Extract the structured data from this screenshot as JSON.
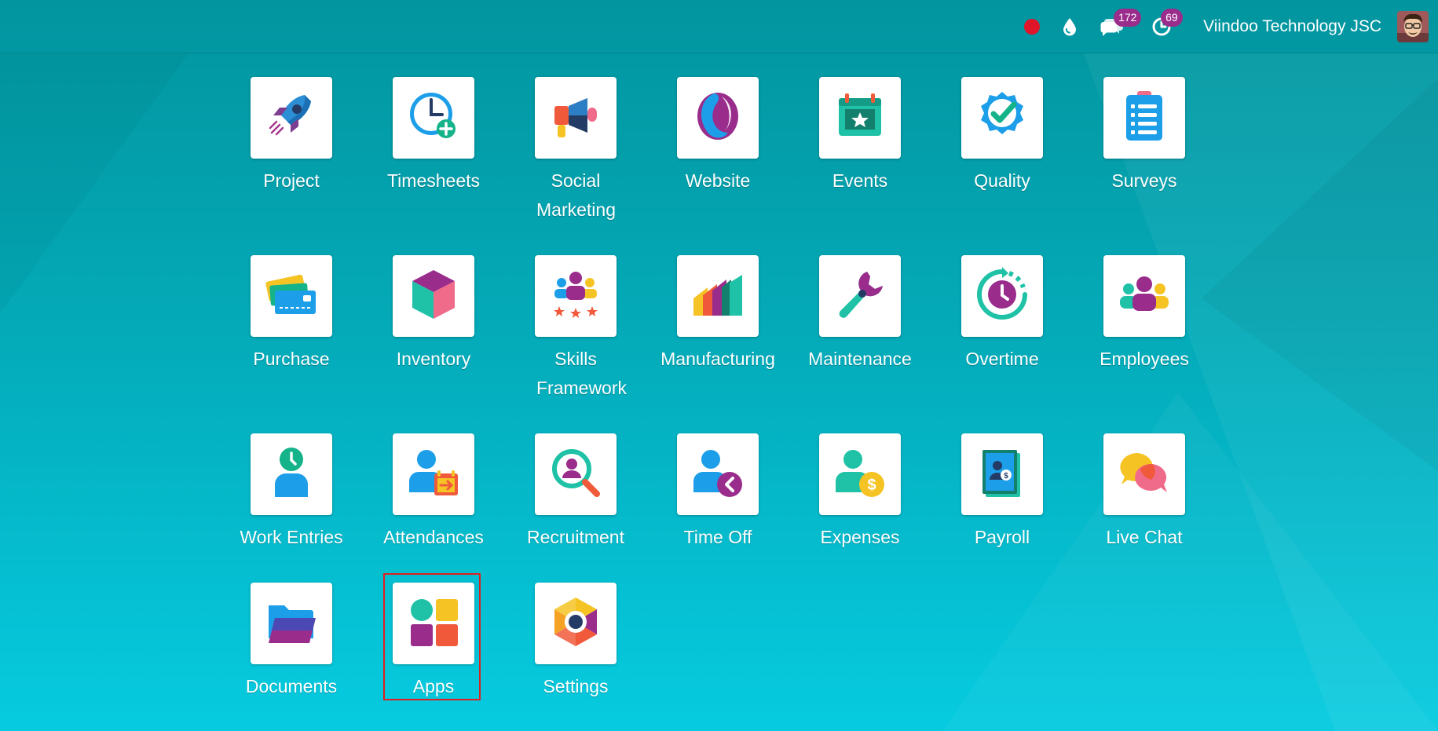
{
  "topbar": {
    "chat_badge": "172",
    "activity_badge": "69",
    "company_name": "Viindoo Technology JSC"
  },
  "apps": [
    {
      "label": "Project",
      "icon": "rocket-icon"
    },
    {
      "label": "Timesheets",
      "icon": "clock-plus-icon"
    },
    {
      "label": "Social Marketing",
      "icon": "megaphone-icon"
    },
    {
      "label": "Website",
      "icon": "website-globe-icon"
    },
    {
      "label": "Events",
      "icon": "calendar-star-icon"
    },
    {
      "label": "Quality",
      "icon": "check-badge-icon"
    },
    {
      "label": "Surveys",
      "icon": "clipboard-list-icon"
    },
    {
      "label": "Purchase",
      "icon": "credit-card-icon"
    },
    {
      "label": "Inventory",
      "icon": "cube-icon"
    },
    {
      "label": "Skills Framework",
      "icon": "people-stars-icon"
    },
    {
      "label": "Manufacturing",
      "icon": "factory-icon"
    },
    {
      "label": "Maintenance",
      "icon": "wrench-icon"
    },
    {
      "label": "Overtime",
      "icon": "clock-cycle-icon"
    },
    {
      "label": "Employees",
      "icon": "people-group-icon"
    },
    {
      "label": "Work Entries",
      "icon": "person-clock-icon"
    },
    {
      "label": "Attendances",
      "icon": "person-calendar-icon"
    },
    {
      "label": "Recruitment",
      "icon": "magnifier-person-icon"
    },
    {
      "label": "Time Off",
      "icon": "person-back-icon"
    },
    {
      "label": "Expenses",
      "icon": "person-dollar-icon"
    },
    {
      "label": "Payroll",
      "icon": "payslip-icon"
    },
    {
      "label": "Live Chat",
      "icon": "chat-bubbles-icon"
    },
    {
      "label": "Documents",
      "icon": "folder-icon"
    },
    {
      "label": "Apps",
      "icon": "apps-grid-icon"
    },
    {
      "label": "Settings",
      "icon": "settings-hexagon-icon"
    }
  ],
  "highlighted_app": "Apps",
  "colors": {
    "background_top": "#02959f",
    "background_bottom": "#06cbe0",
    "badge": "#9a2c8c",
    "record_dot": "#e0152a",
    "highlight": "#e01f1f"
  }
}
